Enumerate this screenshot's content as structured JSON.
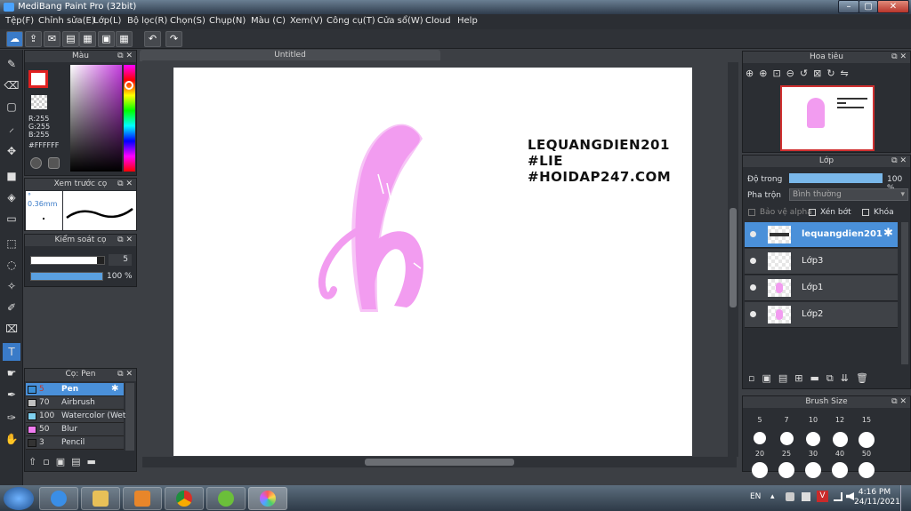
{
  "window": {
    "title": "MediBang Paint Pro (32bit)",
    "controls": [
      "–",
      "▢",
      "✕"
    ]
  },
  "menu": [
    "Tệp(F)",
    "Chỉnh sửa(E)",
    "Lớp(L)",
    "Bộ lọc(R)",
    "Chọn(S)",
    "Chụp(N)",
    "Màu (C)",
    "Xem(V)",
    "Công cụ(T)",
    "Cửa sổ(W)",
    "Cloud",
    "Help"
  ],
  "document": {
    "tab_title": "Untitled"
  },
  "color_panel": {
    "title": "Màu",
    "r": "R:255",
    "g": "G:255",
    "b": "B:255",
    "hex": "#FFFFFF"
  },
  "brush_preview": {
    "title": "Xem trước cọ",
    "size": "° 0.36mm"
  },
  "brush_control": {
    "title": "Kiểm soát cọ",
    "size_value": "5",
    "opacity_value": "100 %",
    "size_fraction": 0.9,
    "opacity_fraction": 1.0
  },
  "brush_list": {
    "title": "Cọ: Pen",
    "items": [
      {
        "size": "5",
        "name": "Pen",
        "color": "#3b8fd6",
        "selected": true
      },
      {
        "size": "70",
        "name": "Airbrush",
        "color": "#c0c0c0",
        "selected": false
      },
      {
        "size": "100",
        "name": "Watercolor (Wet)",
        "color": "#7fd0f0",
        "selected": false
      },
      {
        "size": "50",
        "name": "Blur",
        "color": "#f07cf0",
        "selected": false
      },
      {
        "size": "3",
        "name": "Pencil",
        "color": "#333333",
        "selected": false
      }
    ]
  },
  "canvas_text": {
    "line1": "LEQUANGDIEN201",
    "line2": "#LIE",
    "line3": "#HOIDAP247.COM"
  },
  "navigator": {
    "title": "Hoa tiêu"
  },
  "layers": {
    "title": "Lớp",
    "opacity_label": "Độ trong",
    "opacity_value": "100 %",
    "blend_label": "Pha trộn",
    "blend_value": "Bình thường",
    "protect_alpha": "Bảo vệ alpha",
    "clipping": "Xén bớt",
    "lock": "Khóa",
    "rows": [
      {
        "name": "lequangdien201",
        "selected": true
      },
      {
        "name": "Lớp3",
        "selected": false
      },
      {
        "name": "Lớp1",
        "selected": false
      },
      {
        "name": "Lớp2",
        "selected": false
      }
    ]
  },
  "brush_size": {
    "title": "Brush Size",
    "row1": [
      "5",
      "7",
      "10",
      "12",
      "15"
    ],
    "row2": [
      "20",
      "25",
      "30",
      "40",
      "50"
    ]
  },
  "taskbar": {
    "lang": "EN",
    "time": "4:16 PM",
    "date": "24/11/2021"
  },
  "colors": {
    "accent": "#4a90d9",
    "stroke_pink": "#f29cf0",
    "stroke_light": "#f7c4f6"
  }
}
